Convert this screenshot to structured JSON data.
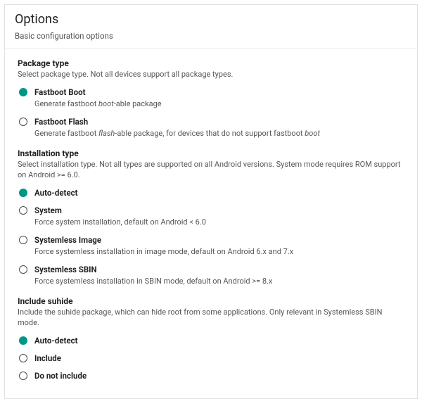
{
  "header": {
    "title": "Options",
    "subtitle": "Basic configuration options"
  },
  "groups": [
    {
      "title": "Package type",
      "desc": "Select package type. Not all devices support all package types.",
      "options": [
        {
          "label": "Fastboot Boot",
          "desc_html": "Generate fastboot <i>boot</i>-able package",
          "selected": true
        },
        {
          "label": "Fastboot Flash",
          "desc_html": "Generate fastboot <i>flash</i>-able package, for devices that do not support fastboot <i>boot</i>",
          "selected": false
        }
      ]
    },
    {
      "title": "Installation type",
      "desc": "Select installation type. Not all types are supported on all Android versions. System mode requires ROM support on Android >= 6.0.",
      "options": [
        {
          "label": "Auto-detect",
          "desc_html": "",
          "selected": true
        },
        {
          "label": "System",
          "desc_html": "Force system installation, default on Android < 6.0",
          "selected": false
        },
        {
          "label": "Systemless Image",
          "desc_html": "Force systemless installation in image mode, default on Android 6.x and 7.x",
          "selected": false
        },
        {
          "label": "Systemless SBIN",
          "desc_html": "Force systemless installation in SBIN mode, default on Android >= 8.x",
          "selected": false
        }
      ]
    },
    {
      "title": "Include suhide",
      "desc": "Include the suhide package, which can hide root from some applications. Only relevant in Systemless SBIN mode.",
      "options": [
        {
          "label": "Auto-detect",
          "desc_html": "",
          "selected": true
        },
        {
          "label": "Include",
          "desc_html": "",
          "selected": false
        },
        {
          "label": "Do not include",
          "desc_html": "",
          "selected": false
        }
      ]
    }
  ]
}
